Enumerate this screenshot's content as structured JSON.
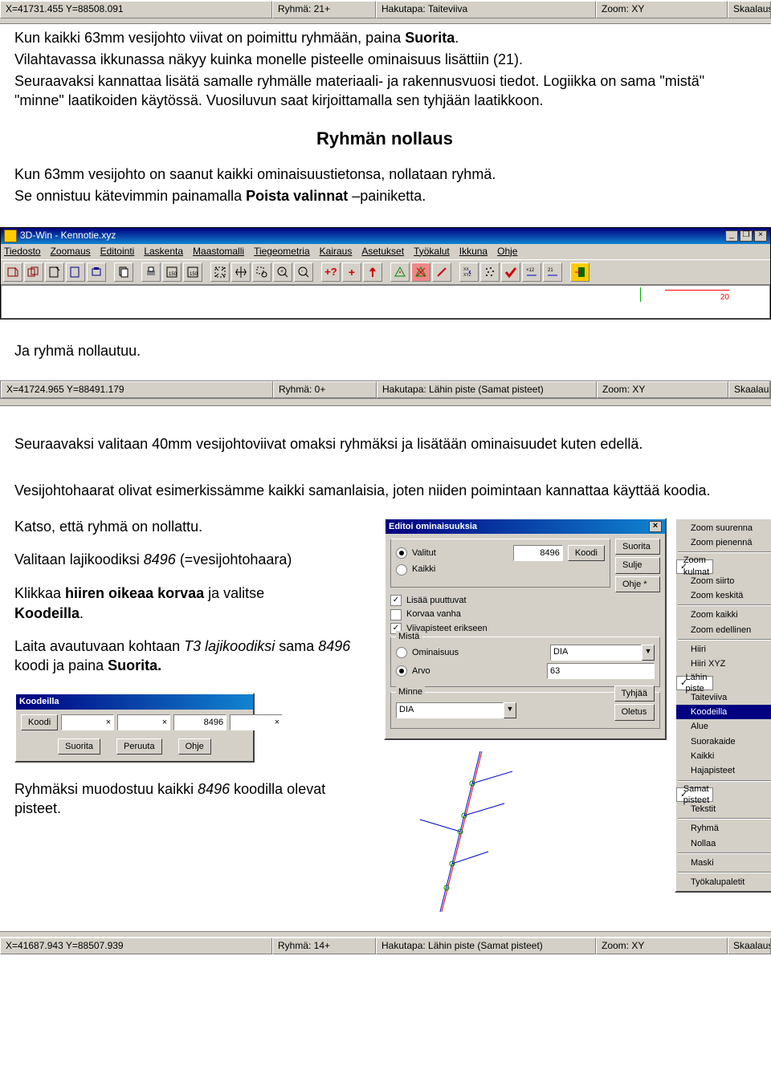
{
  "statusbar1": {
    "xy": "X=41731.455  Y=88508.091",
    "ryhma": "Ryhmä: 21+",
    "haku": "Hakutapa: Taiteviiva",
    "zoom": "Zoom: XY",
    "skaal": "Skaalaus näyttöö"
  },
  "statusbar2": {
    "xy": "X=41724.965  Y=88491.179",
    "ryhma": "Ryhmä: 0+",
    "haku": "Hakutapa: Lähin piste (Samat pisteet)",
    "zoom": "Zoom: XY",
    "skaal": "Skaalaus näyttöö"
  },
  "statusbar3": {
    "xy": "X=41687.943  Y=88507.939",
    "ryhma": "Ryhmä: 14+",
    "haku": "Hakutapa: Lähin piste (Samat pisteet)",
    "zoom": "Zoom: XY",
    "skaal": "Skaalaus näyttöö"
  },
  "para1a": "Kun kaikki 63mm vesijohto viivat on poimittu ryhmään, paina ",
  "para1b": "Suorita",
  "para1c": ".",
  "para2": "Vilahtavassa ikkunassa näkyy kuinka monelle pisteelle ominaisuus lisättiin (21).",
  "para3": "Seuraavaksi kannattaa lisätä samalle ryhmälle materiaali- ja rakennusvuosi tiedot. Logiikka on sama \"mistä\" \"minne\" laatikoiden käytössä. Vuosiluvun saat kirjoittamalla sen tyhjään laatikkoon.",
  "h2": "Ryhmän nollaus",
  "para4": "Kun 63mm vesijohto on saanut kaikki ominaisuustietonsa, nollataan ryhmä.",
  "para5a": "Se onnistuu kätevimmin painamalla ",
  "para5b": "Poista valinnat",
  "para5c": " –painiketta.",
  "wintitle": "3D-Win - Kennotie.xyz",
  "menus": [
    "Tiedosto",
    "Zoomaus",
    "Editointi",
    "Laskenta",
    "Maastomalli",
    "Tiegeometria",
    "Kairaus",
    "Asetukset",
    "Työkalut",
    "Ikkuna",
    "Ohje"
  ],
  "canvas_num": "20",
  "para6": "Ja ryhmä nollautuu.",
  "para7": "Seuraavaksi valitaan 40mm vesijohtoviivat omaksi ryhmäksi ja lisätään ominaisuudet kuten edellä.",
  "para8": "Vesijohtohaarat olivat esimerkissämme kaikki samanlaisia, joten niiden poimintaan kannattaa käyttää koodia.",
  "para9": "Katso, että ryhmä on nollattu.",
  "para10a": "Valitaan lajikoodiksi ",
  "para10b": "8496",
  "para10c": " (=vesijohtohaara)",
  "para11a": "Klikkaa ",
  "para11b": "hiiren oikeaa korvaa",
  "para11c": " ja valitse ",
  "para11d": "Koodeilla",
  "para11e": ".",
  "para12a": "Laita avautuvaan kohtaan ",
  "para12b": "T3 lajikoodiksi",
  "para12c": " sama ",
  "para12d": "8496",
  "para12e": " koodi ja paina ",
  "para12f": "Suorita.",
  "para13a": "Ryhmäksi muodostuu kaikki ",
  "para13b": "8496",
  "para13c": " koodilla olevat pisteet.",
  "dlg_editoi": {
    "title": "Editoi ominaisuuksia",
    "valitut": "Valitut",
    "kaikki": "Kaikki",
    "val": "8496",
    "koodi": "Koodi",
    "suorita": "Suorita",
    "sulje": "Sulje",
    "ohje": "Ohje *",
    "lisaa": "Lisää puuttuvat",
    "korvaa": "Korvaa vanha",
    "viiva": "Viivapisteet erikseen",
    "mista": "Mistä",
    "omin": "Ominaisuus",
    "arvo": "Arvo",
    "mista_combo": "DIA",
    "arvo_val": "63",
    "minne": "Minne",
    "minne_combo": "DIA",
    "tyhjaa": "Tyhjää",
    "oletus": "Oletus"
  },
  "ctx": {
    "items": [
      {
        "t": "Zoom suurenna"
      },
      {
        "t": "Zoom pienennä"
      },
      {
        "sep": true
      },
      {
        "t": "Zoom kulmat",
        "c": true
      },
      {
        "t": "Zoom siirto"
      },
      {
        "t": "Zoom keskitä"
      },
      {
        "sep": true
      },
      {
        "t": "Zoom kaikki"
      },
      {
        "t": "Zoom edellinen"
      },
      {
        "sep": true
      },
      {
        "t": "Hiiri"
      },
      {
        "t": "Hiiri XYZ"
      },
      {
        "t": "Lähin piste",
        "c": true
      },
      {
        "t": "Taiteviiva"
      },
      {
        "t": "Koodeilla",
        "sel": true
      },
      {
        "t": "Alue"
      },
      {
        "t": "Suorakaide"
      },
      {
        "t": "Kaikki"
      },
      {
        "t": "Hajapisteet"
      },
      {
        "sep": true
      },
      {
        "t": "Samat pisteet",
        "c": true
      },
      {
        "t": "Tekstit"
      },
      {
        "sep": true
      },
      {
        "t": "Ryhmä"
      },
      {
        "t": "Nollaa"
      },
      {
        "sep": true
      },
      {
        "t": "Maski"
      },
      {
        "sep": true
      },
      {
        "t": "Työkalupaletit"
      }
    ]
  },
  "koodeilla": {
    "title": "Koodeilla",
    "koodi": "Koodi",
    "v1": "×",
    "v2": "×",
    "v3": "8496",
    "v4": "×",
    "suorita": "Suorita",
    "peruuta": "Peruuta",
    "ohje": "Ohje"
  }
}
